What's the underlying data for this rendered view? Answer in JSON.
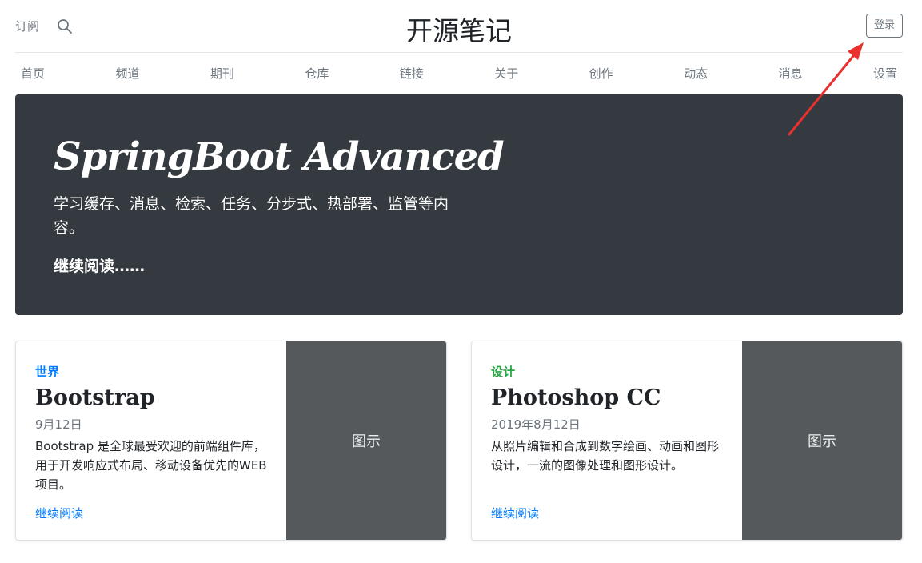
{
  "header": {
    "subscribe": "订阅",
    "title": "开源笔记",
    "login": "登录"
  },
  "nav": [
    "首页",
    "频道",
    "期刊",
    "仓库",
    "链接",
    "关于",
    "创作",
    "动态",
    "消息",
    "设置"
  ],
  "hero": {
    "title": "SpringBoot Advanced",
    "lead": "学习缓存、消息、检索、任务、分步式、热部署、监管等内容。",
    "more": "继续阅读……"
  },
  "cards": [
    {
      "category": "世界",
      "category_color": "#007bff",
      "title": "Bootstrap",
      "date": "9月12日",
      "text": "Bootstrap 是全球最受欢迎的前端组件库，用于开发响应式布局、移动设备优先的WEB项目。",
      "link": "继续阅读",
      "thumb": "图示"
    },
    {
      "category": "设计",
      "category_color": "#28a745",
      "title": "Photoshop CC",
      "date": "2019年8月12日",
      "text": "从照片编辑和合成到数字绘画、动画和图形设计，一流的图像处理和图形设计。",
      "link": "继续阅读",
      "thumb": "图示"
    }
  ],
  "colors": {
    "hero_bg": "#343a40",
    "thumb_bg": "#55595c",
    "link": "#007bff",
    "annotation_arrow": "#e8312f"
  }
}
